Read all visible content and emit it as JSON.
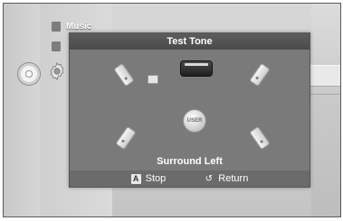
{
  "background_menu": {
    "items": [
      {
        "label": "Music",
        "icon": "music-icon"
      },
      {
        "label": "",
        "icon": "photo-icon"
      }
    ],
    "disc_icon": "disc-icon",
    "settings_icon": "gear-icon"
  },
  "dialog": {
    "title": "Test Tone",
    "speakers": [
      "front-left-speaker",
      "center-speaker",
      "front-right-speaker",
      "subwoofer",
      "surround-left-speaker",
      "surround-right-speaker"
    ],
    "listener_label": "USER",
    "status_text": "Surround Left",
    "footer": {
      "stop_key": "A",
      "stop_label": "Stop",
      "return_icon": "return-icon",
      "return_label": "Return"
    }
  }
}
